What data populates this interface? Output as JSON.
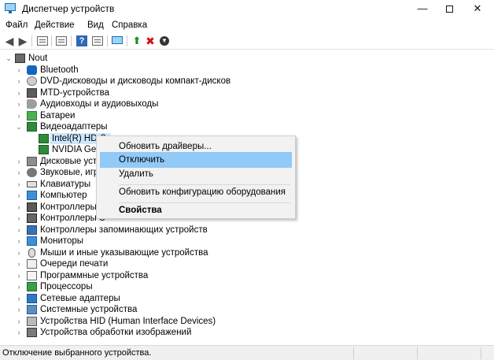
{
  "window": {
    "title": "Диспетчер устройств"
  },
  "menu": {
    "items": [
      "Файл",
      "Действие",
      "Вид",
      "Справка"
    ]
  },
  "toolbar": {
    "icons": [
      "back-arrow-icon",
      "forward-arrow-icon",
      "properties-icon",
      "list-icon",
      "help-icon",
      "view-icon",
      "monitor-scan-icon",
      "add-driver-icon",
      "remove-icon",
      "download-icon"
    ]
  },
  "tree": {
    "root": "Nout",
    "items": [
      {
        "label": "Bluetooth",
        "icon": "bluetooth-icon"
      },
      {
        "label": "DVD-дисководы и дисководы компакт-дисков",
        "icon": "dvd-icon"
      },
      {
        "label": "MTD-устройства",
        "icon": "mtd-icon"
      },
      {
        "label": "Аудиовходы и аудиовыходы",
        "icon": "audio-icon"
      },
      {
        "label": "Батареи",
        "icon": "battery-icon"
      },
      {
        "label": "Видеоадаптеры",
        "icon": "display-adapter-icon"
      },
      {
        "label": "Intel(R) HD Gr",
        "icon": "display-adapter-icon"
      },
      {
        "label": "NVIDIA GeFo",
        "icon": "display-adapter-icon"
      },
      {
        "label": "Дисковые устро",
        "icon": "disk-icon"
      },
      {
        "label": "Звуковые, игров",
        "icon": "sound-icon"
      },
      {
        "label": "Клавиатуры",
        "icon": "keyboard-icon"
      },
      {
        "label": "Компьютер",
        "icon": "computer-icon"
      },
      {
        "label": "Контроллеры ID",
        "icon": "ide-icon"
      },
      {
        "label": "Контроллеры U",
        "icon": "usb-icon"
      },
      {
        "label": "Контроллеры запоминающих устройств",
        "icon": "storage-icon"
      },
      {
        "label": "Мониторы",
        "icon": "monitor-icon"
      },
      {
        "label": "Мыши и иные указывающие устройства",
        "icon": "mouse-icon"
      },
      {
        "label": "Очереди печати",
        "icon": "print-queue-icon"
      },
      {
        "label": "Программные устройства",
        "icon": "software-icon"
      },
      {
        "label": "Процессоры",
        "icon": "cpu-icon"
      },
      {
        "label": "Сетевые адаптеры",
        "icon": "network-icon"
      },
      {
        "label": "Системные устройства",
        "icon": "system-icon"
      },
      {
        "label": "Устройства HID (Human Interface Devices)",
        "icon": "hid-icon"
      },
      {
        "label": "Устройства обработки изображений",
        "icon": "imaging-icon"
      }
    ]
  },
  "context_menu": {
    "update_drivers": "Обновить драйверы...",
    "disable": "Отключить",
    "delete": "Удалить",
    "scan_hardware": "Обновить конфигурацию оборудования",
    "properties": "Свойства"
  },
  "status": {
    "text": "Отключение выбранного устройства."
  }
}
